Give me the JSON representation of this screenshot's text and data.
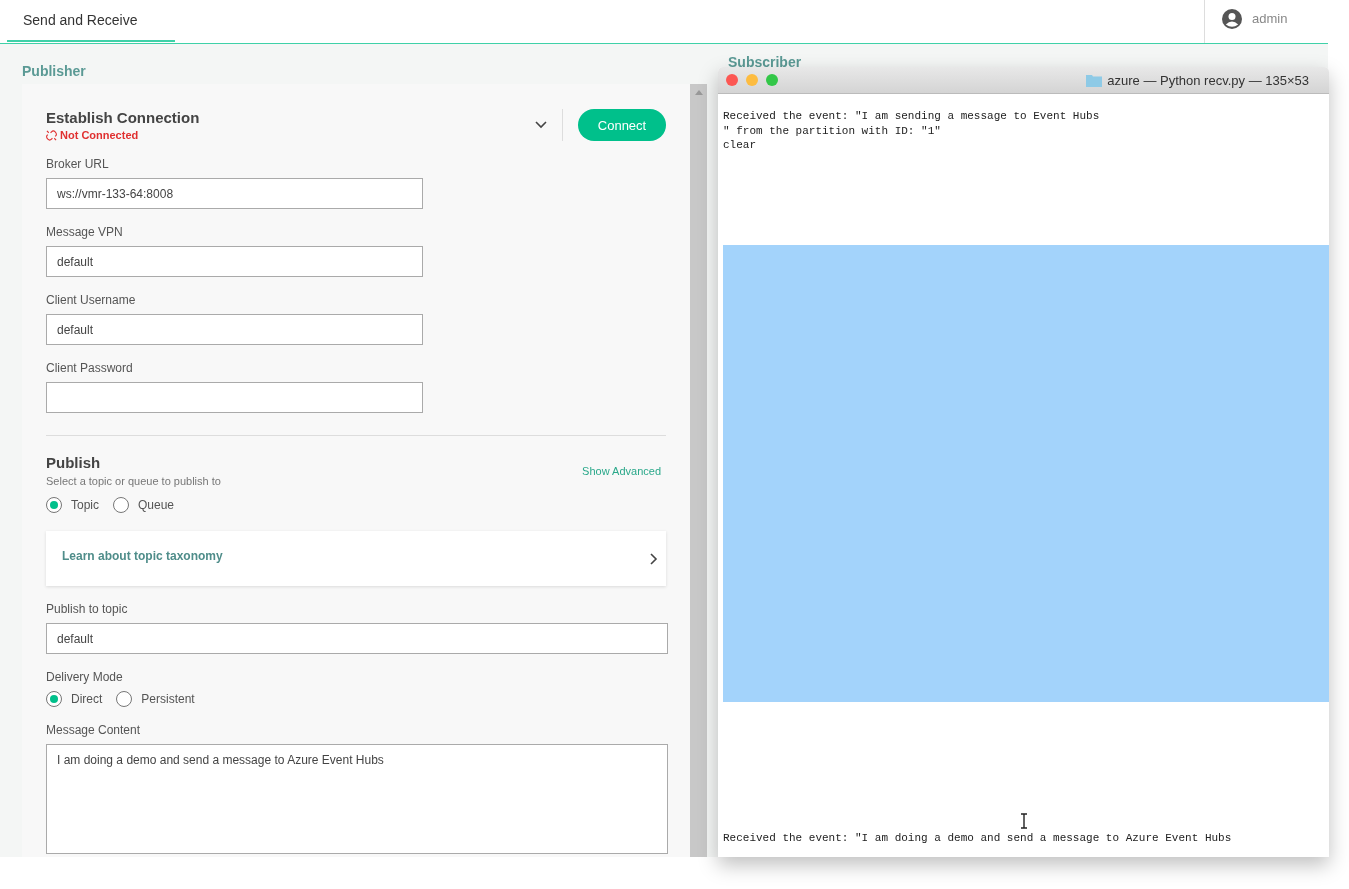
{
  "header": {
    "tabs": [
      {
        "label": "Send and Receive",
        "selected": true
      }
    ],
    "user": "admin"
  },
  "publisher": {
    "title": "Publisher",
    "connection": {
      "title": "Establish Connection",
      "status": "Not Connected",
      "connected": false,
      "button": "Connect"
    },
    "fields": [
      {
        "label": "Broker URL",
        "value": "ws://vmr-133-64:8008"
      },
      {
        "label": "Message VPN",
        "value": "default"
      },
      {
        "label": "Client Username",
        "value": "default"
      },
      {
        "label": "Client Password"
      }
    ],
    "publish": {
      "title": "Publish",
      "subtitle": "Select a topic or queue to publish to",
      "advanced": "Show Advanced",
      "destination": [
        {
          "label": "Topic",
          "selected": true
        },
        {
          "label": "Queue",
          "selected": false
        }
      ],
      "link": "Learn about topic taxonomy",
      "topic_label": "Publish to topic",
      "topic": "default",
      "delivery_label": "Delivery Mode",
      "delivery": [
        {
          "label": "Direct",
          "selected": true
        },
        {
          "label": "Persistent",
          "selected": false
        }
      ],
      "content_label": "Message Content",
      "content": "I am doing a demo and send a message to Azure Event Hubs"
    }
  },
  "subscriber": {
    "title": "Subscriber"
  },
  "terminal": {
    "title": "azure — Python recv.py — 135×53",
    "lines": [
      "Received the event: \"I am sending a message to Event Hubs",
      "\" from the partition with ID: \"1\"",
      "clear"
    ],
    "last_line": "Received the event: \"I am doing a demo and send a message to Azure Event Hubs"
  }
}
